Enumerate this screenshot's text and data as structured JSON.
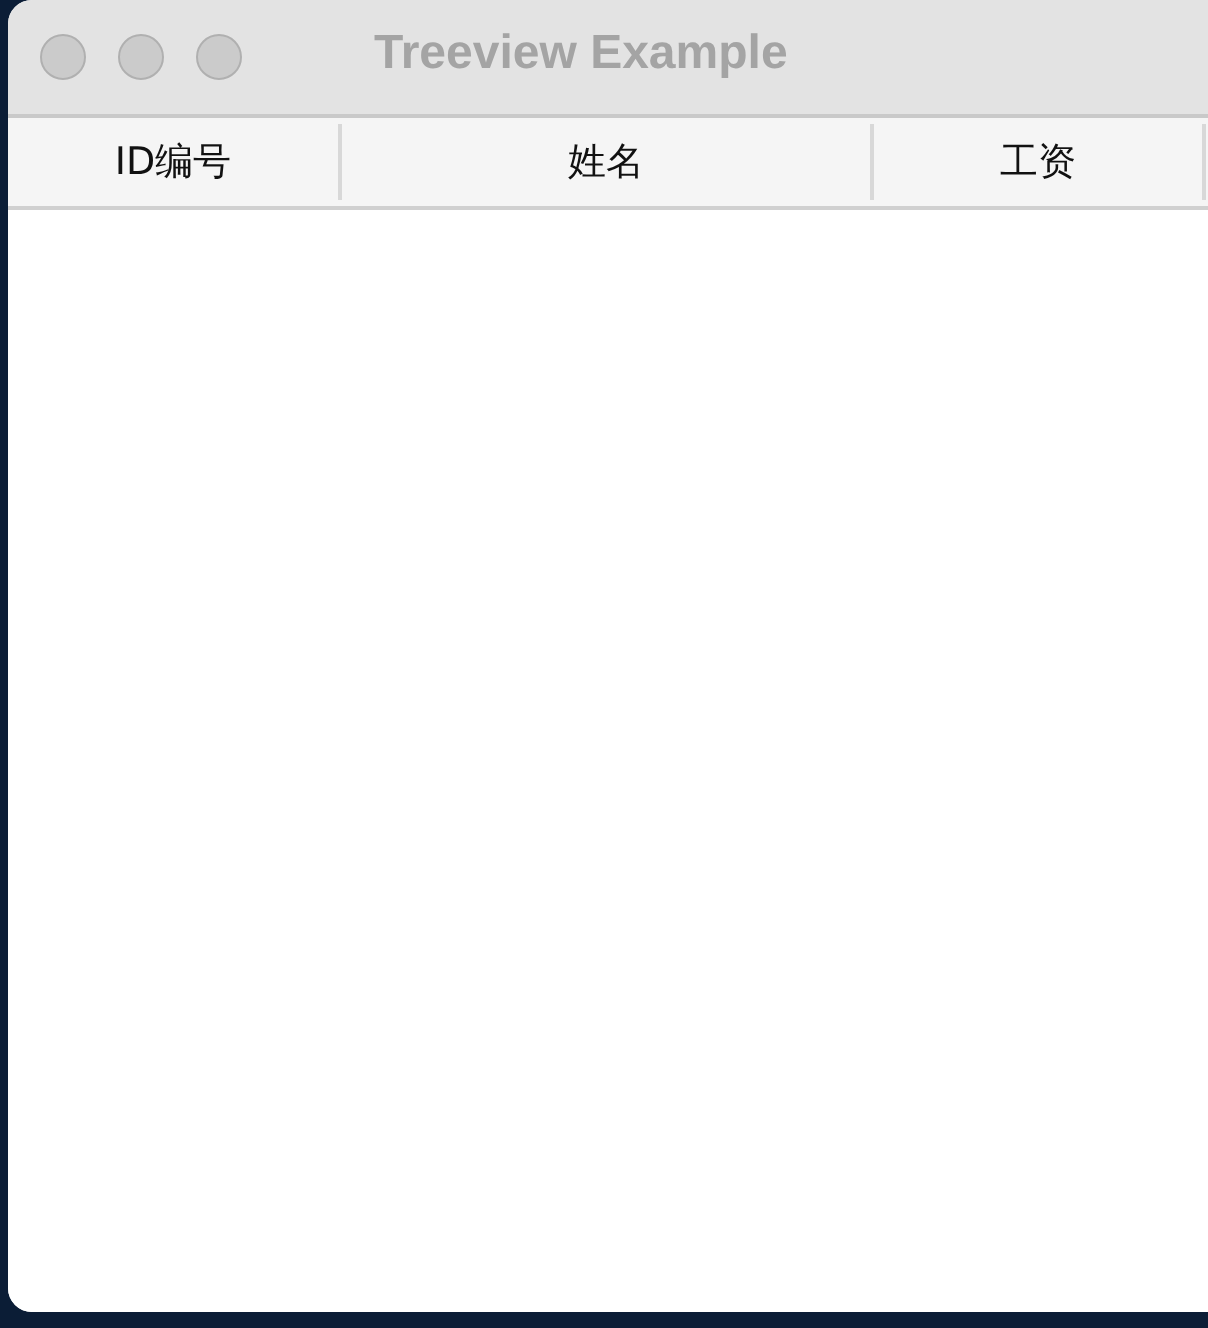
{
  "window": {
    "title": "Treeview Example"
  },
  "table": {
    "columns": [
      "ID编号",
      "姓名",
      "工资"
    ]
  }
}
